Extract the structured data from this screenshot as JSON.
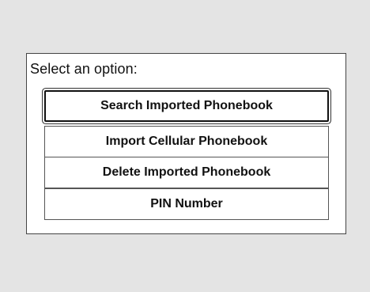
{
  "dialog": {
    "prompt": "Select an option:",
    "options": [
      {
        "label": "Search Imported Phonebook",
        "selected": true
      },
      {
        "label": "Import Cellular  Phonebook",
        "selected": false
      },
      {
        "label": "Delete Imported Phonebook",
        "selected": false
      },
      {
        "label": "PIN Number",
        "selected": false
      }
    ]
  },
  "colors": {
    "background": "#e4e4e4",
    "panel": "#ffffff",
    "border": "#444444",
    "text": "#111111"
  }
}
